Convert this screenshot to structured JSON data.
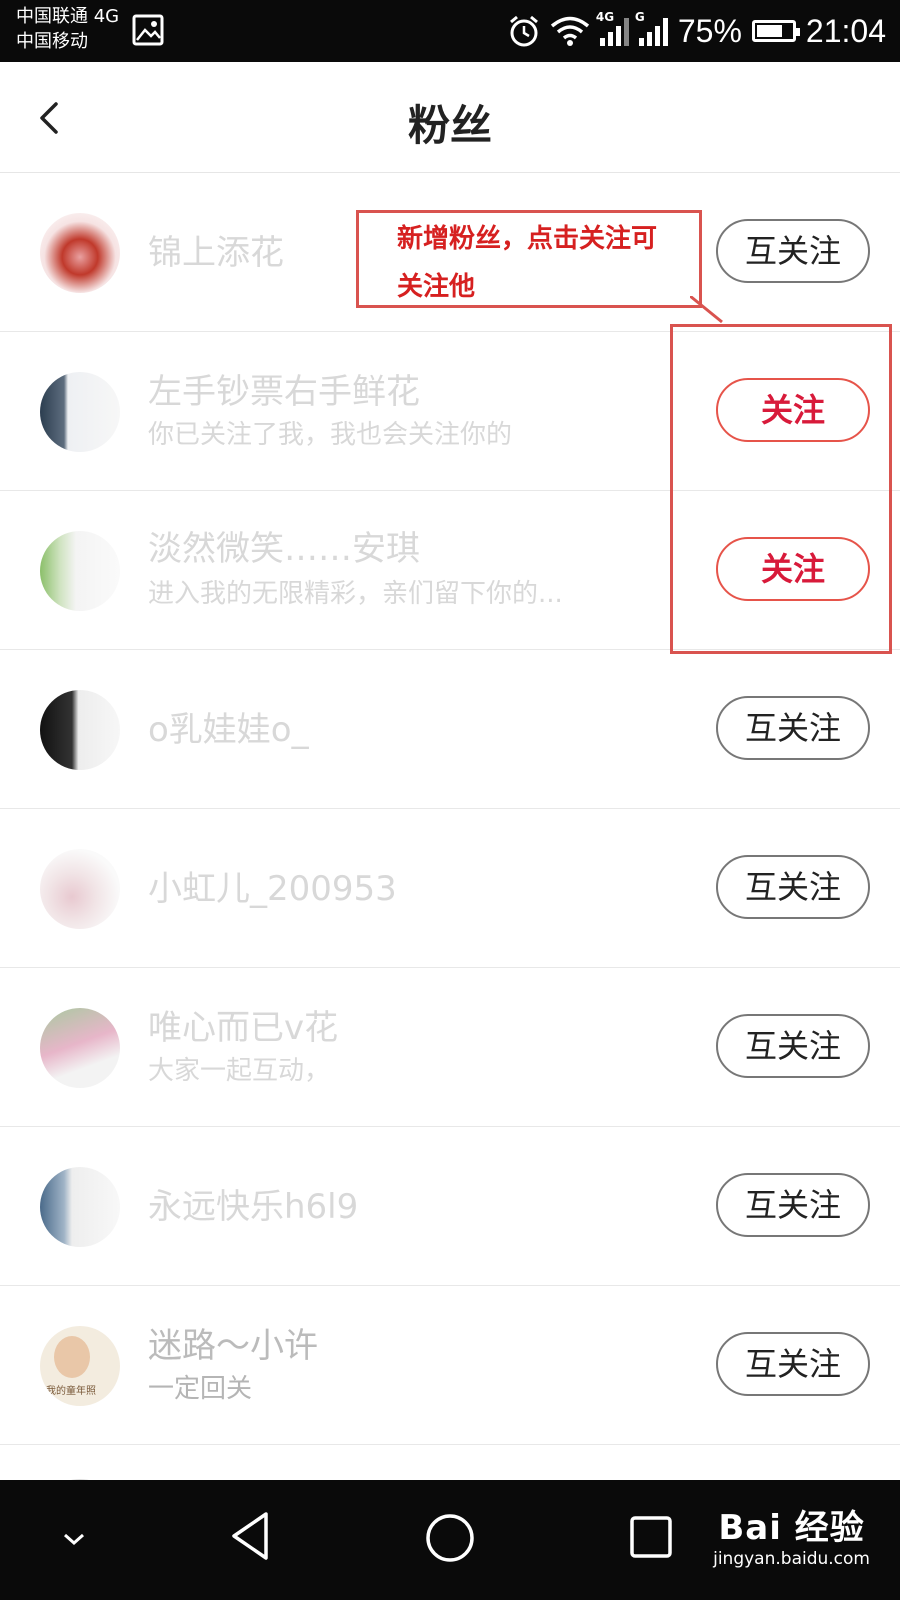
{
  "status_bar": {
    "carrier1": "中国联通 4G",
    "carrier2": "中国移动",
    "net1": "4G",
    "net2": "G",
    "battery": "75%",
    "battery_level": 0.75,
    "time": "21:04"
  },
  "header": {
    "title": "粉丝"
  },
  "callout": {
    "line1": "新增粉丝，点击关注可",
    "line2": "关注他"
  },
  "fans": [
    {
      "name": "锦上添花",
      "subtitle": "",
      "button": "互关注",
      "following": true
    },
    {
      "name": "左手钞票右手鲜花",
      "subtitle": "你已关注了我，我也会关注你的",
      "button": "关注",
      "following": false
    },
    {
      "name": "淡然微笑……安琪",
      "subtitle": "进入我的无限精彩，亲们留下你的...",
      "button": "关注",
      "following": false
    },
    {
      "name": "o乳娃娃o_",
      "subtitle": "",
      "button": "互关注",
      "following": true
    },
    {
      "name": "小虹儿_200953",
      "subtitle": "",
      "button": "互关注",
      "following": true
    },
    {
      "name": "唯心而已v花",
      "subtitle": "大家一起互动，",
      "button": "互关注",
      "following": true
    },
    {
      "name": "永远快乐h6l9",
      "subtitle": "",
      "button": "互关注",
      "following": true
    },
    {
      "name": "迷路～小许",
      "subtitle": "一定回关",
      "button": "互关注",
      "following": true
    }
  ],
  "avatar_caption": "我的童年照",
  "watermark": {
    "brand": "Bai 经验",
    "url": "jingyan.baidu.com"
  },
  "colors": {
    "accent": "#d81a3a",
    "annotation": "#d9534f"
  }
}
